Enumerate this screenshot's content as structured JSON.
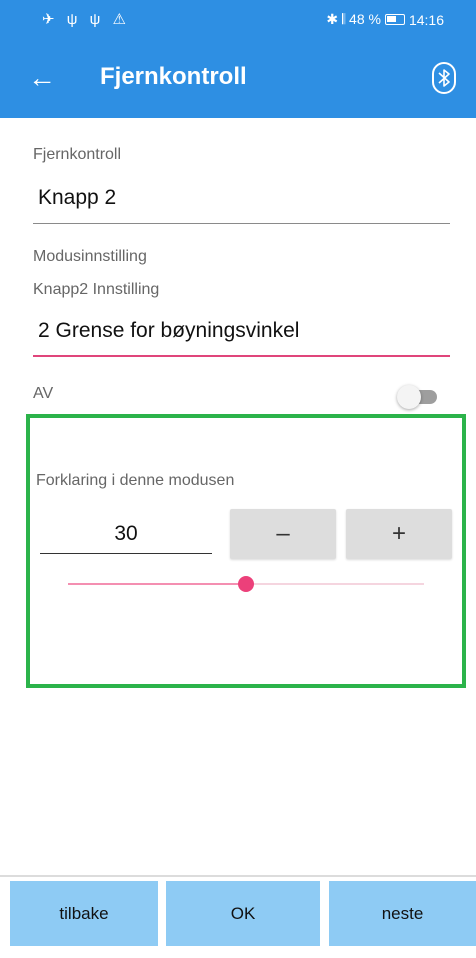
{
  "status_bar": {
    "left_icons": "✈ ψ ψ ⚠",
    "right_text": "✱ 𝄃 48 %",
    "time": "14:16",
    "battery_icon": "battery-charging-icon"
  },
  "app_bar": {
    "title": "Fjernkontroll",
    "back_icon": "arrow-left-icon",
    "bluetooth_icon": "bluetooth-icon",
    "color": "#2e8fe3"
  },
  "form": {
    "remote_label": "Fjernkontroll",
    "remote_value": "Knapp 2",
    "mode_label": "Modusinnstilling",
    "button_setting_label": "Knapp2 Innstilling",
    "mode_value": "2 Grense for bøyningsvinkel",
    "toggle_label": "AV",
    "toggle_on": false
  },
  "panel": {
    "border_color": "#2bb34a",
    "explanation_label": "Forklaring i denne modusen",
    "value": "30",
    "minus_label": "–",
    "plus_label": "+",
    "slider_fraction": 0.5,
    "accent_color": "#ec407a"
  },
  "bottom": {
    "back_label": "tilbake",
    "ok_label": "OK",
    "next_label": "neste",
    "button_color": "#8ecbf4"
  }
}
